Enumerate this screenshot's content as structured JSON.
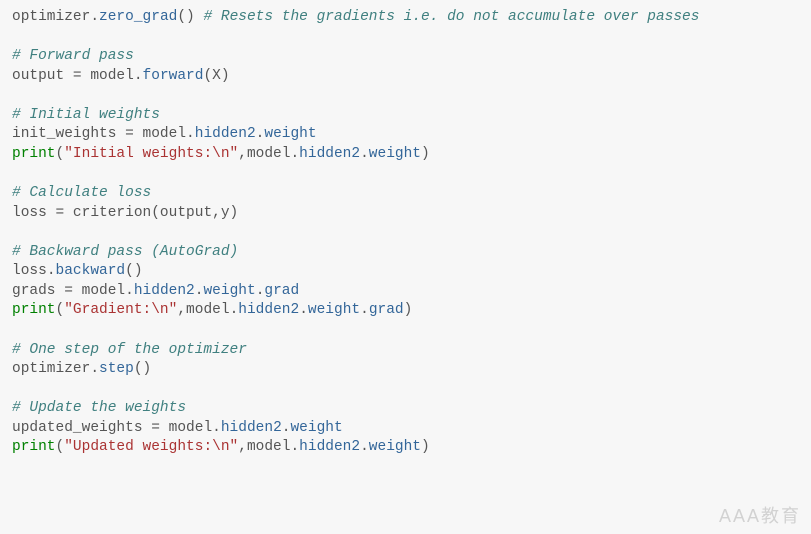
{
  "watermark": "AAA教育",
  "code": {
    "l01": {
      "id1": "optimizer",
      "dot1": ".",
      "m1": "zero_grad",
      "paren": "()",
      "sp": " ",
      "cmt": "# Resets the gradients i.e. do not accumulate over passes"
    },
    "l03": {
      "cmt": "# Forward pass"
    },
    "l04": {
      "id1": "output ",
      "op": "=",
      "id2": " model",
      "dot": ".",
      "m": "forward",
      "args": "(X)"
    },
    "l06": {
      "cmt": "# Initial weights"
    },
    "l07": {
      "id1": "init_weights ",
      "op": "=",
      "id2": " model",
      "d1": ".",
      "a1": "hidden2",
      "d2": ".",
      "a2": "weight"
    },
    "l08": {
      "kw": "print",
      "p1": "(",
      "str": "\"Initial weights:\\n\"",
      "c": ",",
      "id": "model",
      "d1": ".",
      "a1": "hidden2",
      "d2": ".",
      "a2": "weight",
      "p2": ")"
    },
    "l10": {
      "cmt": "# Calculate loss"
    },
    "l11": {
      "id1": "loss ",
      "op": "=",
      "rest": " criterion(output,y)"
    },
    "l13": {
      "cmt": "# Backward pass (AutoGrad)"
    },
    "l14": {
      "id1": "loss",
      "d": ".",
      "m": "backward",
      "paren": "()"
    },
    "l15": {
      "id1": "grads ",
      "op": "=",
      "id2": " model",
      "d1": ".",
      "a1": "hidden2",
      "d2": ".",
      "a2": "weight",
      "d3": ".",
      "a3": "grad"
    },
    "l16": {
      "kw": "print",
      "p1": "(",
      "str": "\"Gradient:\\n\"",
      "c": ",",
      "id": "model",
      "d1": ".",
      "a1": "hidden2",
      "d2": ".",
      "a2": "weight",
      "d3": ".",
      "a3": "grad",
      "p2": ")"
    },
    "l18": {
      "cmt": "# One step of the optimizer"
    },
    "l19": {
      "id1": "optimizer",
      "d": ".",
      "m": "step",
      "paren": "()"
    },
    "l21": {
      "cmt": "# Update the weights"
    },
    "l22": {
      "id1": "updated_weights ",
      "op": "=",
      "id2": " model",
      "d1": ".",
      "a1": "hidden2",
      "d2": ".",
      "a2": "weight"
    },
    "l23": {
      "kw": "print",
      "p1": "(",
      "str": "\"Updated weights:\\n\"",
      "c": ",",
      "id": "model",
      "d1": ".",
      "a1": "hidden2",
      "d2": ".",
      "a2": "weight",
      "p2": ")"
    }
  }
}
